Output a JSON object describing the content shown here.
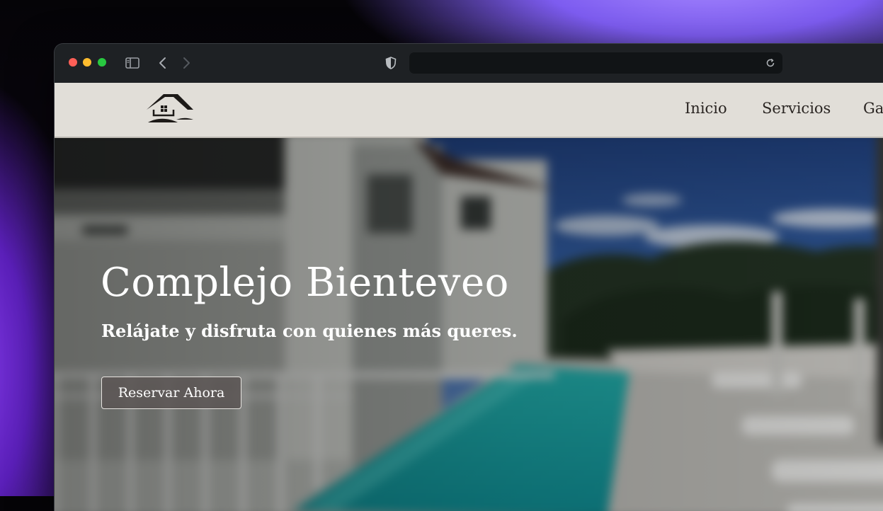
{
  "browser": {
    "address_bar": {
      "url": ""
    },
    "icons": {
      "sidebar": "sidebar-toggle-icon",
      "back": "chevron-left-icon",
      "forward": "chevron-right-icon",
      "privacy": "shield-icon",
      "reload": "reload-icon"
    },
    "traffic_lights": {
      "close": "#fe5f57",
      "minimize": "#febc2e",
      "zoom": "#28c840"
    }
  },
  "site": {
    "logo_icon": "house-logo-icon",
    "nav": {
      "items": [
        {
          "label": "Inicio"
        },
        {
          "label": "Servicios"
        },
        {
          "label": "Ga"
        }
      ]
    },
    "hero": {
      "title": "Complejo Bienteveo",
      "subtitle": "Relájate y disfruta con quienes más queres.",
      "cta_label": "Reservar Ahora"
    },
    "colors": {
      "navbar_bg": "#e1ded8",
      "pool": "#1aa6a6",
      "sky": "#2f5aa8"
    }
  }
}
